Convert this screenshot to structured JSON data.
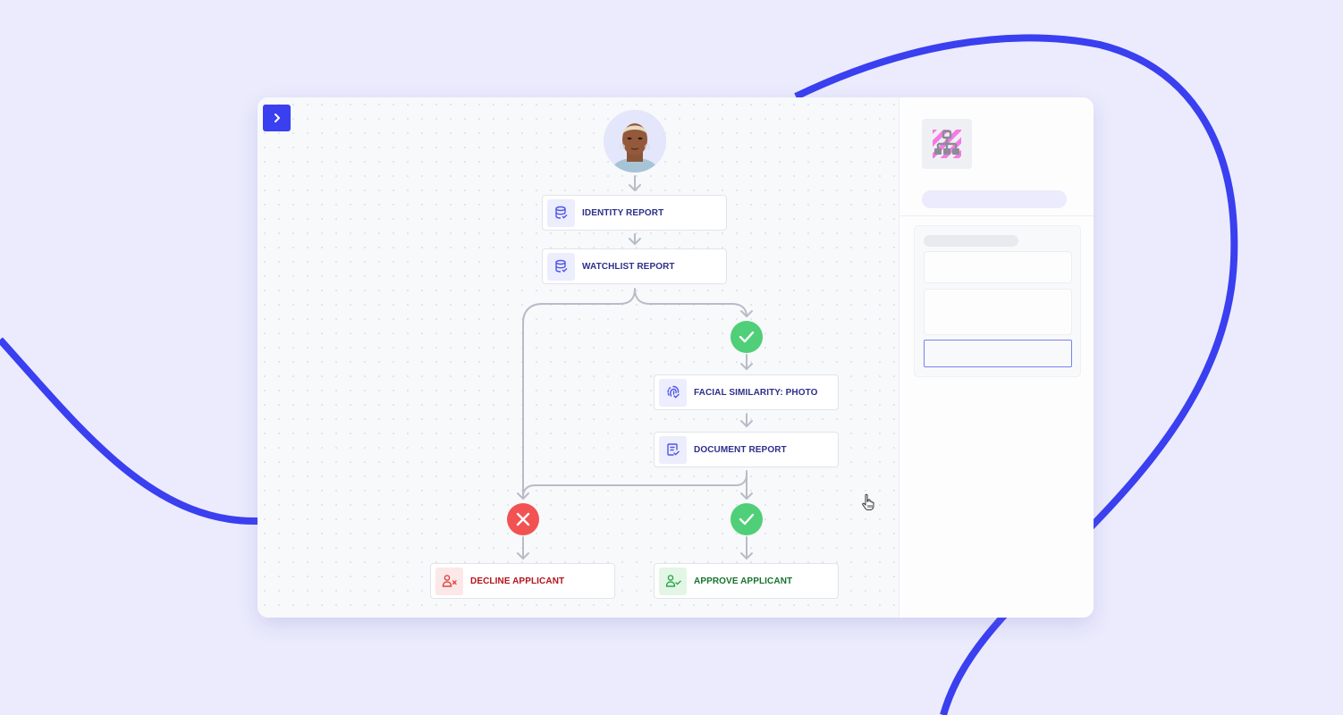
{
  "colors": {
    "background": "#ebebfd",
    "accent": "#3a3ff0",
    "pass": "#4fcf77",
    "fail": "#f25252",
    "edge": "#b8bcc8"
  },
  "toolbar": {
    "toggle_icon": "chevron-right-icon"
  },
  "workflow": {
    "start": {
      "icon": "applicant-avatar"
    },
    "nodes": [
      {
        "id": "identity_report",
        "label": "IDENTITY REPORT",
        "icon": "database-check-icon",
        "type": "task"
      },
      {
        "id": "watchlist_report",
        "label": "WATCHLIST REPORT",
        "icon": "database-check-icon",
        "type": "task"
      },
      {
        "id": "facial_similarity_photo",
        "label": "FACIAL SIMILARITY: PHOTO",
        "icon": "face-scan-icon",
        "type": "task"
      },
      {
        "id": "document_report",
        "label": "DOCUMENT REPORT",
        "icon": "document-check-icon",
        "type": "task"
      },
      {
        "id": "decline_applicant",
        "label": "DECLINE APPLICANT",
        "icon": "user-x-icon",
        "type": "decline"
      },
      {
        "id": "approve_applicant",
        "label": "APPROVE APPLICANT",
        "icon": "user-check-icon",
        "type": "approve"
      }
    ],
    "conditions": [
      {
        "id": "watchlist_pass",
        "result": "pass",
        "icon": "check-icon"
      },
      {
        "id": "final_fail",
        "result": "fail",
        "icon": "x-icon"
      },
      {
        "id": "final_pass",
        "result": "pass",
        "icon": "check-icon"
      }
    ]
  },
  "panel": {
    "logo_icon": "workflow-hierarchy-icon"
  }
}
